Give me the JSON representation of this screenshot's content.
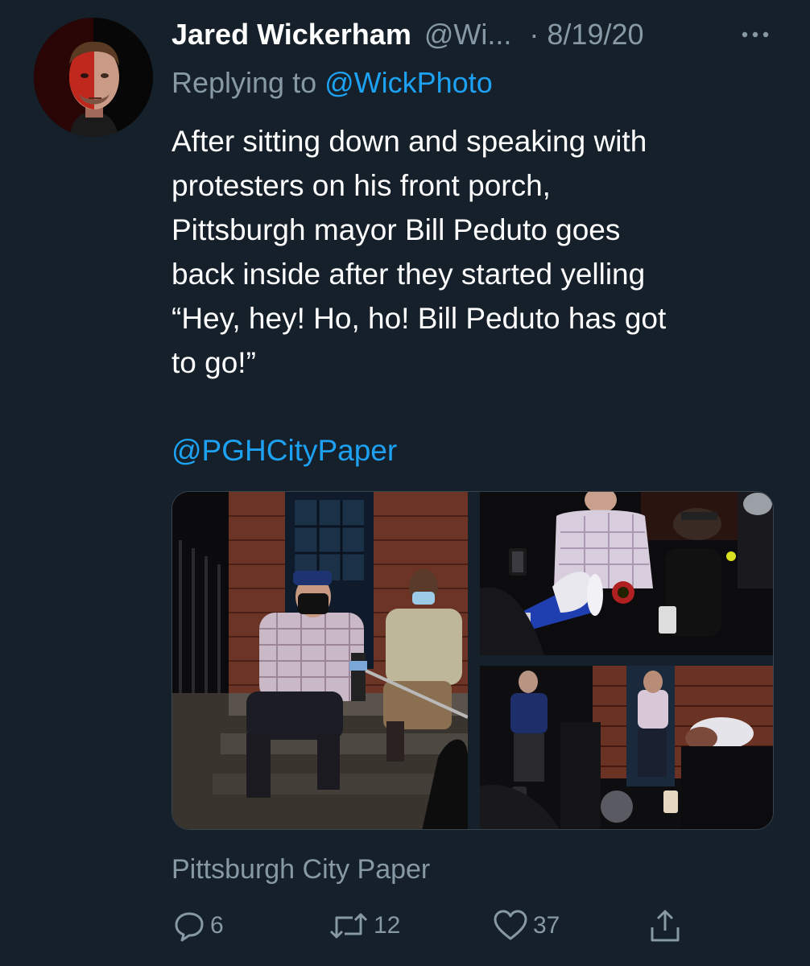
{
  "tweet": {
    "author": {
      "name": "Jared Wickerham",
      "handle": "@Wi...",
      "date": "8/19/20",
      "date_separator": "·"
    },
    "replying": {
      "prefix": "Replying to ",
      "handle": "@WickPhoto"
    },
    "text": "After sitting down and speaking with\nprotesters on his front porch,\nPittsburgh mayor Bill Peduto goes\nback inside after they started yelling\n“Hey, hey! Ho, ho! Bill Peduto has got\nto go!”",
    "mention": "@PGHCityPaper",
    "card_source": "Pittsburgh City Paper",
    "actions": {
      "reply_count": "6",
      "retweet_count": "12",
      "like_count": "37"
    }
  },
  "icons": [
    "more-icon",
    "reply-icon",
    "retweet-icon",
    "like-icon",
    "share-icon"
  ],
  "colors": {
    "background": "#15202b",
    "text": "#ffffff",
    "secondary": "#8899a6",
    "link": "#1da1f2"
  }
}
